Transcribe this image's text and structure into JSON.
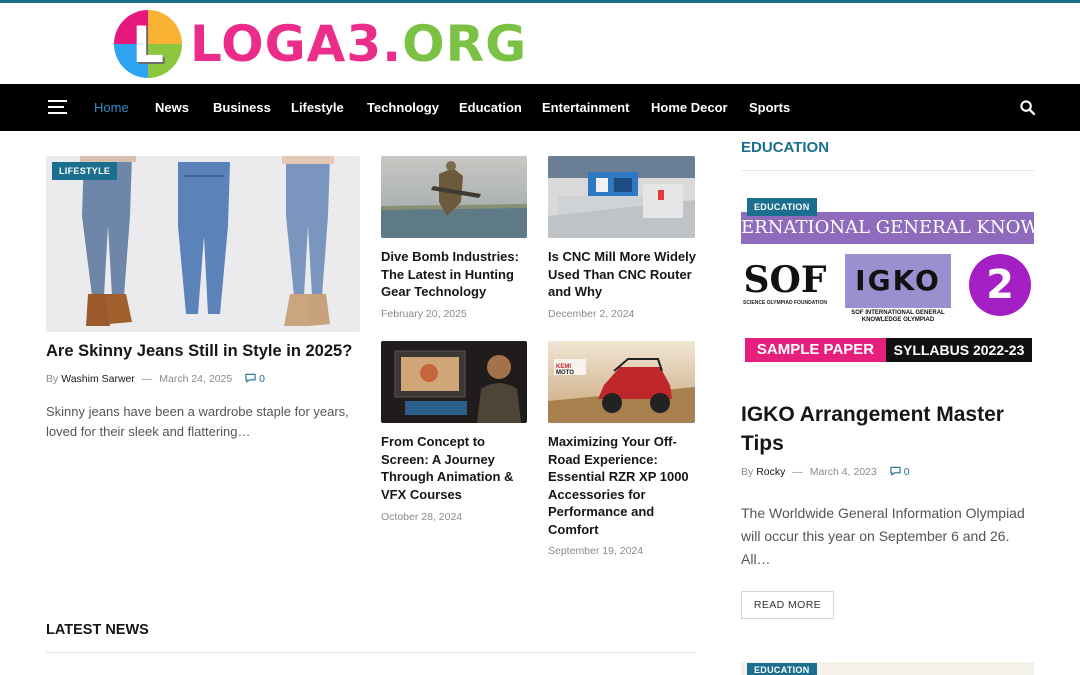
{
  "logo": {
    "mark": "L",
    "text_pink": "LOGA3.",
    "text_green": "ORG"
  },
  "nav": {
    "items": [
      "Home",
      "News",
      "Business",
      "Lifestyle",
      "Technology",
      "Education",
      "Entertainment",
      "Home Decor",
      "Sports"
    ],
    "active": "Home"
  },
  "featured": {
    "category": "LIFESTYLE",
    "title": "Are Skinny Jeans Still in Style in 2025?",
    "by": "By",
    "author": "Washim Sarwer",
    "date": "March 24, 2025",
    "comments": "0",
    "excerpt": "Skinny jeans have been a wardrobe staple for years, loved for their sleek and flattering…"
  },
  "grid": [
    {
      "title": "Dive Bomb Industries: The Latest in Hunting Gear Technology",
      "date": "February 20, 2025"
    },
    {
      "title": "Is CNC Mill More Widely Used Than CNC Router and Why",
      "date": "December 2, 2024"
    },
    {
      "title": "From Concept to Screen: A Journey Through Animation & VFX Courses",
      "date": "October 28, 2024"
    },
    {
      "title": "Maximizing Your Off-Road Experience: Essential RZR XP 1000 Accessories for Performance and Comfort",
      "date": "September 19, 2024"
    }
  ],
  "latest_heading": "LATEST NEWS",
  "sidebar": {
    "heading": "EDUCATION",
    "category": "EDUCATION",
    "image_banner": "ERNATIONAL GENERAL KNOWLEDGE OLYMPI",
    "image_sof": "SOF",
    "image_sof_caption": "SCIENCE OLYMPIAD FOUNDATION",
    "image_igko": "IGKO",
    "image_igko_caption": "SOF INTERNATIONAL GENERAL KNOWLEDGE OLYMPIAD",
    "image_badge": "2",
    "image_sample": "SAMPLE PAPER",
    "image_syllabus": "SYLLABUS 2022-23",
    "title": "IGKO Arrangement Master Tips",
    "by": "By",
    "author": "Rocky",
    "date": "March 4, 2023",
    "comments": "0",
    "excerpt": "The Worldwide General Information Olympiad will occur this year on September 6 and 26. All…",
    "read_more": "READ MORE",
    "next_category": "EDUCATION"
  },
  "colors": {
    "accent": "#1a6f8f",
    "nav_bg": "#000000",
    "nav_active": "#2e8fc4",
    "logo_pink": "#ec2c8b",
    "logo_green": "#7bc144"
  },
  "icons": {
    "menu": "hamburger-icon",
    "search": "search-icon",
    "comment": "comment-icon"
  }
}
